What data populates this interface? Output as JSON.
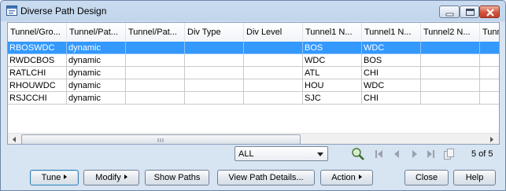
{
  "window": {
    "title": "Diverse Path Design"
  },
  "table": {
    "columns": [
      "Tunnel/Gro...",
      "Tunnel/Pat...",
      "Tunnel/Pat...",
      "Div Type",
      "Div Level",
      "Tunnel1 N...",
      "Tunnel1 N...",
      "Tunnel2 N...",
      "Tunn"
    ],
    "rows": [
      [
        "RBOSWDC",
        "dynamic",
        "",
        "",
        "",
        "BOS",
        "WDC",
        "",
        ""
      ],
      [
        "RWDCBOS",
        "dynamic",
        "",
        "",
        "",
        "WDC",
        "BOS",
        "",
        ""
      ],
      [
        "RATLCHI",
        "dynamic",
        "",
        "",
        "",
        "ATL",
        "CHI",
        "",
        ""
      ],
      [
        "RHOUWDC",
        "dynamic",
        "",
        "",
        "",
        "HOU",
        "WDC",
        "",
        ""
      ],
      [
        "RSJCCHI",
        "dynamic",
        "",
        "",
        "",
        "SJC",
        "CHI",
        "",
        ""
      ]
    ]
  },
  "filter": {
    "selected": "ALL"
  },
  "pagination": {
    "count_text": "5 of 5"
  },
  "buttons": {
    "tune": "Tune",
    "modify": "Modify",
    "show_paths": "Show Paths",
    "view_path_details": "View Path Details...",
    "action": "Action",
    "close": "Close",
    "help": "Help"
  },
  "colors": {
    "selection": "#3399ff",
    "window_frame": "#c1d5ec"
  },
  "icons": [
    "app-icon",
    "minimize-icon",
    "maximize-icon",
    "close-icon",
    "find-icon",
    "first-page-icon",
    "prev-page-icon",
    "next-page-icon",
    "last-page-icon",
    "copy-icon"
  ]
}
